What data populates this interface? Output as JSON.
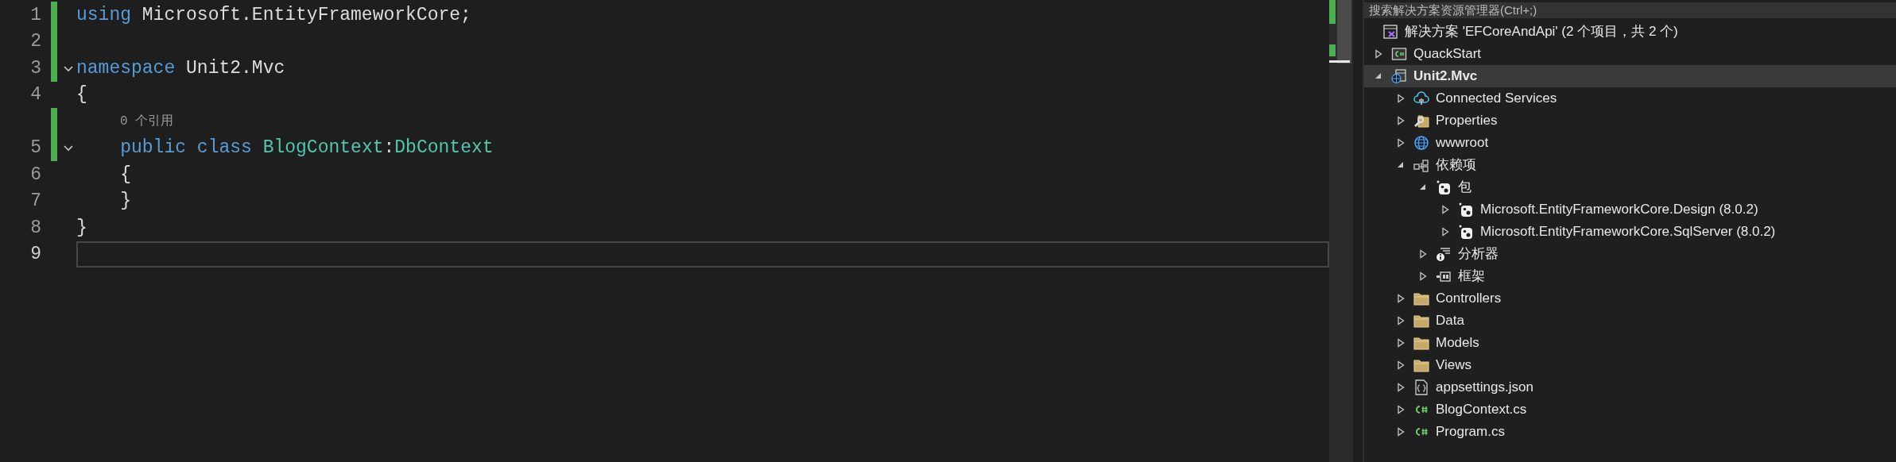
{
  "editor": {
    "lines": [
      {
        "number": "1",
        "changed": true,
        "selected": false,
        "tokens": [
          {
            "kind": "keyword",
            "text": "using"
          },
          {
            "kind": "text",
            "text": " Microsoft.EntityFrameworkCore;"
          }
        ]
      },
      {
        "number": "2",
        "changed": true,
        "selected": false
      },
      {
        "number": "3",
        "changed": true,
        "selected": false,
        "expanded": true,
        "tokens": [
          {
            "kind": "keyword",
            "text": "namespace"
          },
          {
            "kind": "text",
            "text": " Unit2.Mvc"
          }
        ]
      },
      {
        "number": "4",
        "changed": false,
        "selected": false,
        "tokens": [
          {
            "kind": "text",
            "text": "{"
          }
        ]
      },
      {
        "number": "5",
        "changed": true,
        "selected": false,
        "expanded": true,
        "codelens": "0 个引用",
        "tokens": [
          {
            "kind": "keyword",
            "text": "    public"
          },
          {
            "kind": "keyword",
            "text": " class"
          },
          {
            "kind": "type",
            "text": " BlogContext"
          },
          {
            "kind": "text",
            "text": ":"
          },
          {
            "kind": "type",
            "text": "DbContext"
          }
        ]
      },
      {
        "number": "6",
        "changed": false,
        "selected": false,
        "tokens": [
          {
            "kind": "text",
            "text": "    {"
          }
        ]
      },
      {
        "number": "7",
        "changed": false,
        "selected": false,
        "tokens": [
          {
            "kind": "text",
            "text": "    }"
          }
        ]
      },
      {
        "number": "8",
        "changed": false,
        "selected": false,
        "tokens": [
          {
            "kind": "text",
            "text": "}"
          }
        ]
      },
      {
        "number": "9",
        "changed": false,
        "selected": true
      }
    ]
  },
  "explorer": {
    "search": {
      "placeholder": "搜索解决方案资源管理器(Ctrl+;)"
    },
    "solution": {
      "label": "解决方案 'EFCoreAndApi' (2 个项目，共 2 个)",
      "kind": "solution",
      "children": [
        {
          "label": "QuackStart",
          "kind": "csproj",
          "expanded": false,
          "selected": false,
          "startup": false
        },
        {
          "label": "Unit2.Mvc",
          "kind": "webproj",
          "expanded": true,
          "selected": true,
          "startup": true,
          "children": [
            {
              "label": "Connected Services",
              "kind": "connected",
              "expanded": false,
              "selected": false
            },
            {
              "label": "Properties",
              "kind": "properties",
              "expanded": false,
              "selected": false
            },
            {
              "label": "wwwroot",
              "kind": "globe",
              "expanded": false,
              "selected": false
            },
            {
              "label": "依赖项",
              "kind": "dependencies",
              "expanded": true,
              "selected": false,
              "children": [
                {
                  "label": "包",
                  "kind": "package",
                  "expanded": true,
                  "selected": false,
                  "children": [
                    {
                      "label": "Microsoft.EntityFrameworkCore.Design (8.0.2)",
                      "kind": "package",
                      "expanded": false,
                      "selected": false
                    },
                    {
                      "label": "Microsoft.EntityFrameworkCore.SqlServer (8.0.2)",
                      "kind": "package",
                      "expanded": false,
                      "selected": false
                    }
                  ]
                },
                {
                  "label": "分析器",
                  "kind": "analyzer",
                  "expanded": false,
                  "selected": false
                },
                {
                  "label": "框架",
                  "kind": "framework",
                  "expanded": false,
                  "selected": false
                }
              ]
            },
            {
              "label": "Controllers",
              "kind": "folder",
              "expanded": false,
              "selected": false
            },
            {
              "label": "Data",
              "kind": "folder",
              "expanded": false,
              "selected": false
            },
            {
              "label": "Models",
              "kind": "folder",
              "expanded": false,
              "selected": false
            },
            {
              "label": "Views",
              "kind": "folder",
              "expanded": false,
              "selected": false
            },
            {
              "label": "appsettings.json",
              "kind": "json",
              "expanded": false,
              "selected": false
            },
            {
              "label": "BlogContext.cs",
              "kind": "cs",
              "expanded": false,
              "selected": false
            },
            {
              "label": "Program.cs",
              "kind": "cs",
              "expanded": false,
              "selected": false
            }
          ]
        }
      ]
    }
  }
}
